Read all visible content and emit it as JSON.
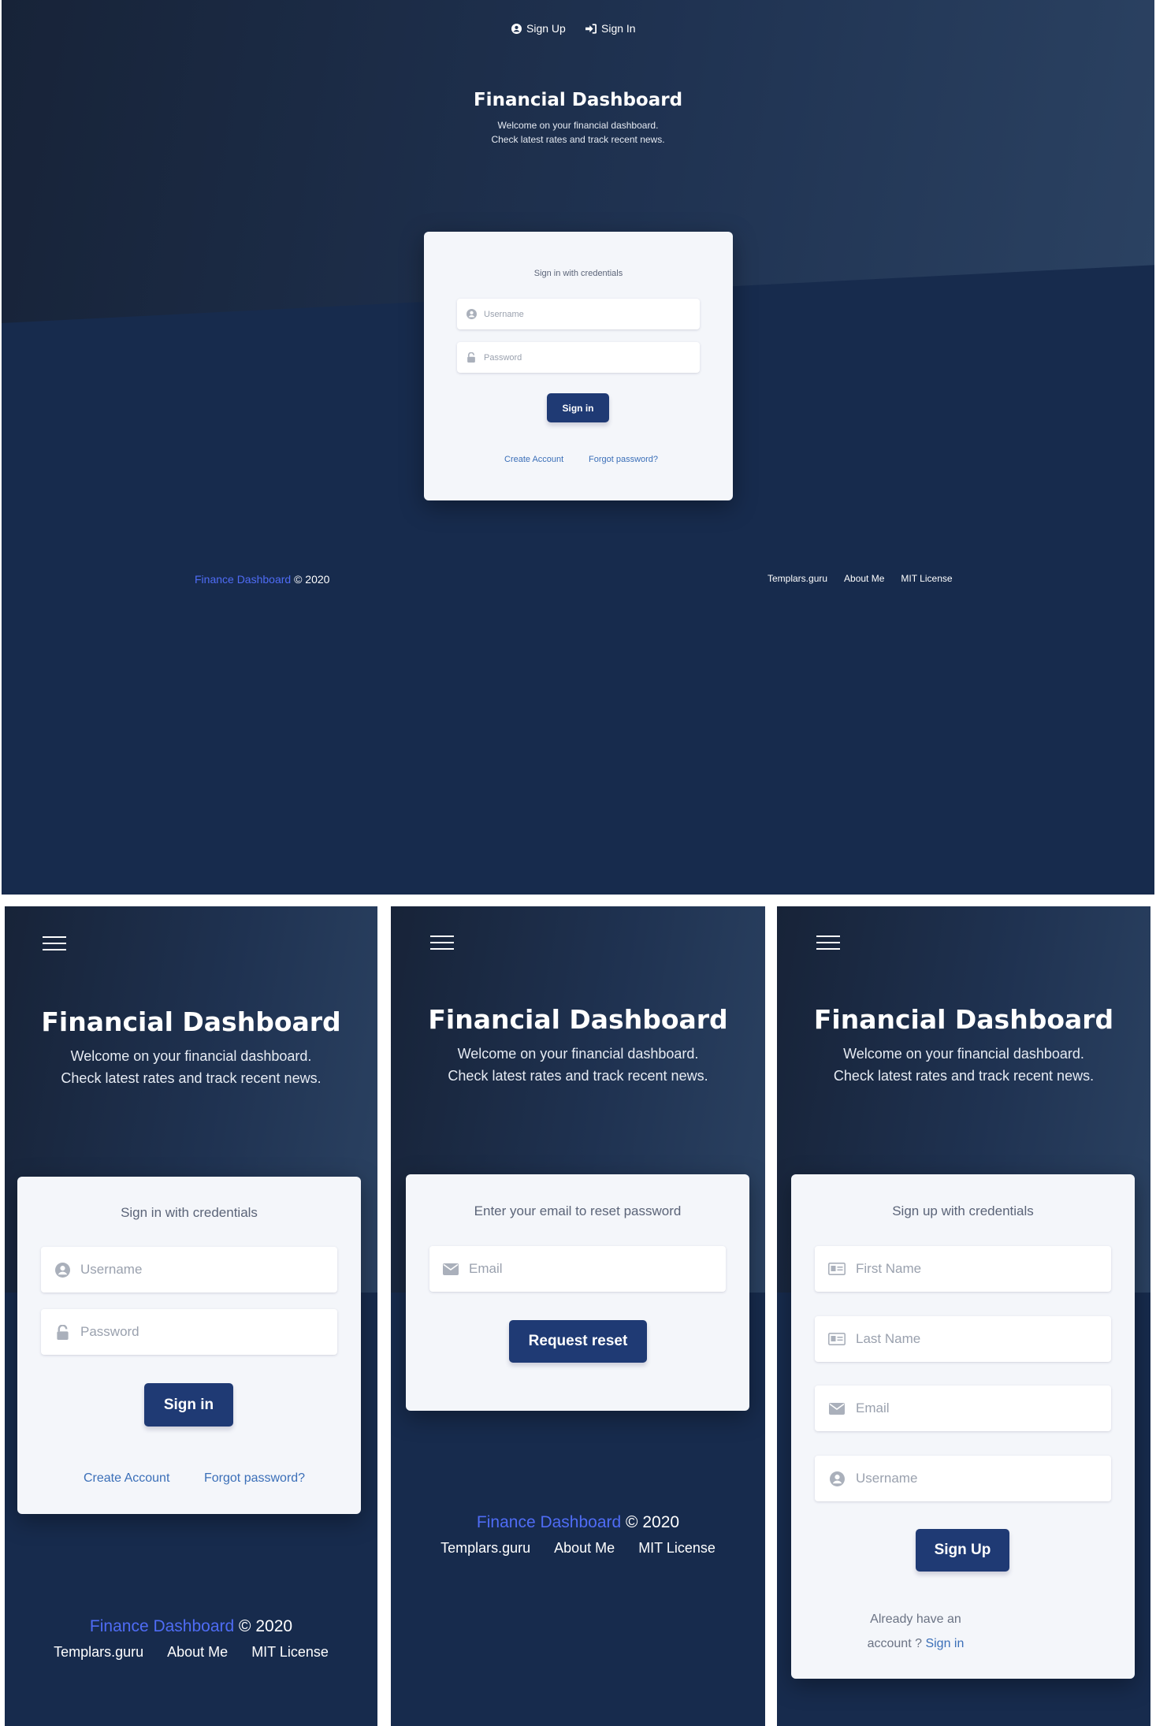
{
  "nav": {
    "signup_label": "Sign Up",
    "signin_label": "Sign In"
  },
  "hero": {
    "title": "Financial Dashboard",
    "subtitle_line1": "Welcome on your financial dashboard.",
    "subtitle_line2": "Check latest rates and track recent news."
  },
  "signin": {
    "heading": "Sign in with credentials",
    "username_placeholder": "Username",
    "password_placeholder": "Password",
    "button": "Sign in",
    "create_account": "Create Account",
    "forgot_password": "Forgot password?"
  },
  "reset": {
    "heading": "Enter your email to reset password",
    "email_placeholder": "Email",
    "button": "Request reset"
  },
  "signup": {
    "heading": "Sign up with credentials",
    "first_name_placeholder": "First Name",
    "last_name_placeholder": "Last Name",
    "email_placeholder": "Email",
    "username_placeholder": "Username",
    "button": "Sign Up",
    "already_line1": "Already have an",
    "already_line2": "account ?",
    "signin_link": "Sign in"
  },
  "footer": {
    "brand": "Finance Dashboard",
    "copyright": "© 2020",
    "links": [
      "Templars.guru",
      "About Me",
      "MIT License"
    ]
  },
  "colors": {
    "background_navy": "#172b4d",
    "button_blue": "#1f3a74",
    "link_blue": "#3b6fb8",
    "brand_blue": "#4f6cf5"
  },
  "icons": [
    "user-circle-icon",
    "sign-in-icon",
    "user-icon",
    "lock-icon",
    "envelope-icon",
    "id-card-icon",
    "hamburger-menu-icon"
  ]
}
